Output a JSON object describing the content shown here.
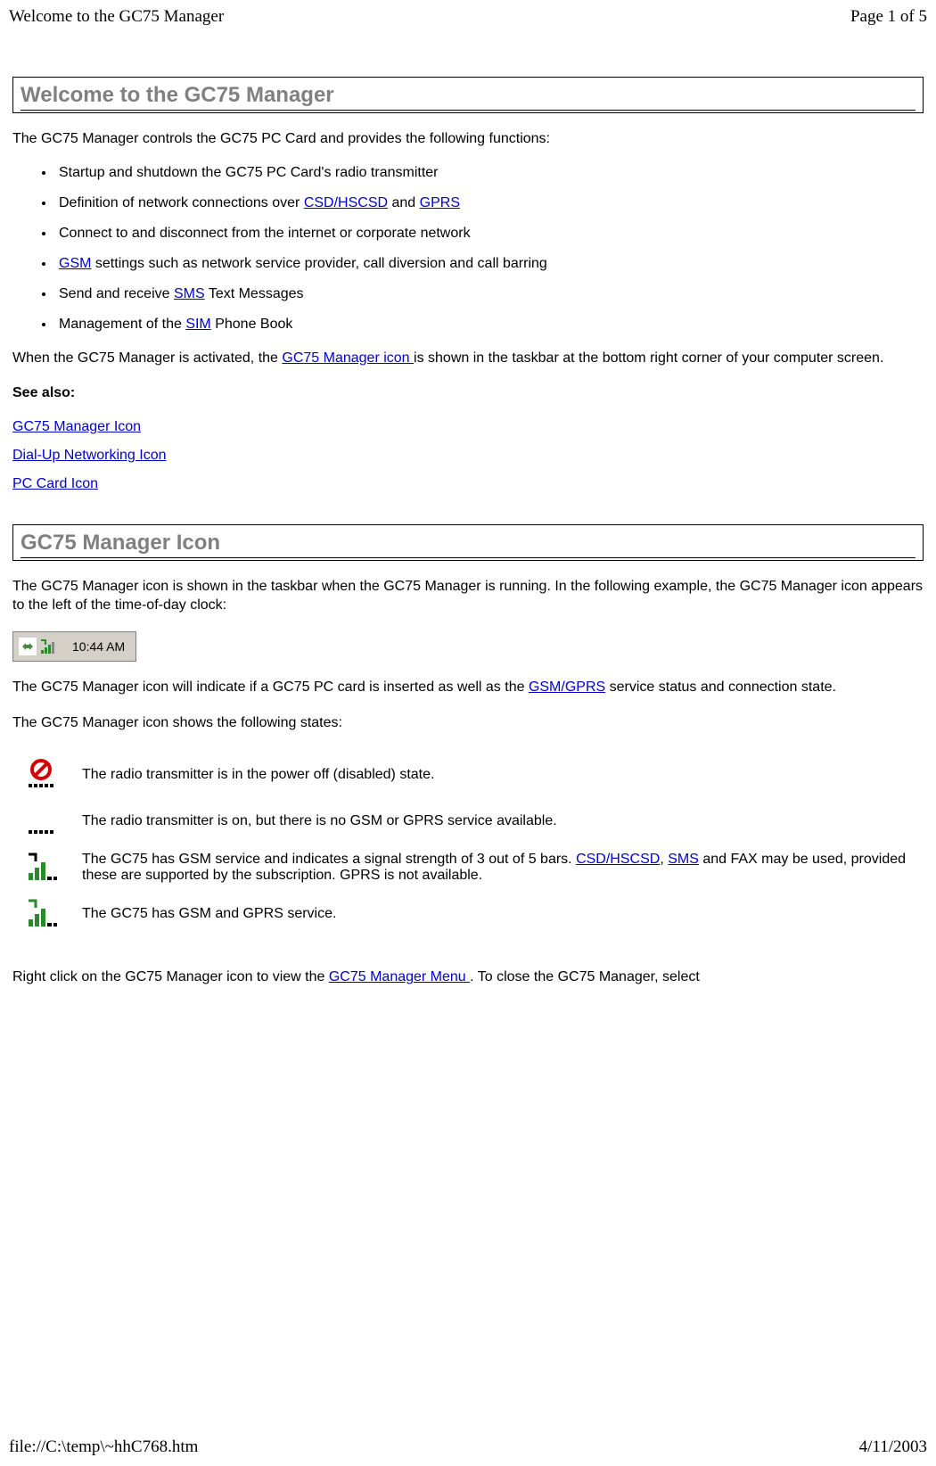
{
  "header": {
    "title": "Welcome to the GC75 Manager",
    "page_num": "Page 1 of 5"
  },
  "footer": {
    "path": "file://C:\\temp\\~hhC768.htm",
    "date": "4/11/2003"
  },
  "section1": {
    "title": "Welcome to the GC75 Manager",
    "intro": "The GC75 Manager controls the GC75 PC Card and provides the following functions:",
    "bullets": {
      "b1": "Startup and shutdown the GC75 PC Card's radio transmitter",
      "b2_pre": "Definition of network connections over ",
      "b2_link1": "CSD/HSCSD",
      "b2_mid": " and ",
      "b2_link2": "GPRS",
      "b3": "Connect to and disconnect from the internet or corporate network",
      "b4_link": "GSM",
      "b4_post": " settings such as network service provider, call diversion and call barring",
      "b5_pre": "Send and receive ",
      "b5_link": "SMS",
      "b5_post": " Text Messages",
      "b6_pre": "Management of the ",
      "b6_link": "SIM",
      "b6_post": " Phone Book"
    },
    "para2_pre": "When the GC75 Manager is activated, the ",
    "para2_link": "GC75 Manager icon ",
    "para2_post": "is shown in the taskbar at the bottom right corner of your computer screen.",
    "see_also": "See also:",
    "links": {
      "l1": "GC75 Manager Icon",
      "l2": "Dial-Up Networking Icon",
      "l3": "PC Card Icon"
    }
  },
  "section2": {
    "title": "GC75 Manager Icon",
    "para1": "The GC75 Manager icon is shown in the taskbar when the GC75 Manager is running. In the following example, the GC75 Manager icon appears to the left of the time-of-day clock:",
    "taskbar_time": "10:44 AM",
    "para2_pre": "The GC75 Manager icon will indicate if a GC75 PC card is inserted as well as the ",
    "para2_link": "GSM/GPRS",
    "para2_post": " service status and connection state.",
    "para3": "The GC75 Manager icon shows the following states:",
    "states": {
      "s1": "The radio transmitter is in the power off (disabled) state.",
      "s2": "The radio transmitter is on, but there is no GSM or GPRS service available.",
      "s3_pre": "The GC75 has GSM service and indicates a signal strength of 3 out of 5 bars. ",
      "s3_link1": "CSD/HSCSD",
      "s3_mid": ", ",
      "s3_link2": "SMS",
      "s3_post": " and FAX may be used, provided these are supported by the subscription. GPRS is not available.",
      "s4": "The GC75 has GSM and GPRS service."
    },
    "para4_pre": "Right click on the GC75 Manager icon to view the ",
    "para4_link": "GC75 Manager Menu ",
    "para4_post": ". To close the GC75 Manager, select"
  }
}
